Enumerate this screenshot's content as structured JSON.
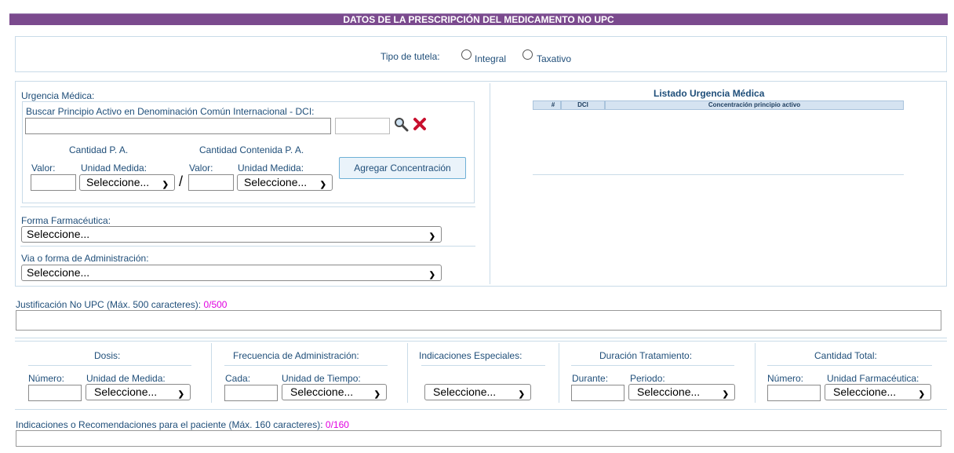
{
  "header": {
    "title": "DATOS DE LA PRESCRIPCIÓN DEL MEDICAMENTO NO UPC"
  },
  "tutela": {
    "label": "Tipo de tutela:",
    "options": [
      "Integral",
      "Taxativo"
    ]
  },
  "urgencia": {
    "title": "Urgencia Médica:",
    "search_label": "Buscar Principio Activo en Denominación Común Internacional - DCI:",
    "cantidad_pa": "Cantidad P. A.",
    "cantidad_contenida": "Cantidad Contenida P. A.",
    "valor": "Valor:",
    "unidad_medida": "Unidad Medida:",
    "select_value": "Seleccione...",
    "separator": "/",
    "add_button": "Agregar Concentración",
    "forma_label": "Forma Farmacéutica:",
    "via_label": "Via o forma de Administración:"
  },
  "listado": {
    "title": "Listado Urgencia Médica",
    "columns": [
      "#",
      "DCI",
      "Concentración principio activo"
    ]
  },
  "justificacion": {
    "label": "Justificación No UPC (Máx. 500 caracteres):",
    "counter": "0/500"
  },
  "dosis": {
    "title": "Dosis:",
    "numero": "Número:",
    "unidad": "Unidad de Medida:",
    "select": "Seleccione..."
  },
  "frecuencia": {
    "title": "Frecuencia de Administración:",
    "cada": "Cada:",
    "unidad": "Unidad de Tiempo:",
    "select": "Seleccione..."
  },
  "indicaciones_esp": {
    "title": "Indicaciones Especiales:",
    "select": "Seleccione..."
  },
  "duracion": {
    "title": "Duración Tratamiento:",
    "durante": "Durante:",
    "periodo": "Periodo:",
    "select": "Seleccione..."
  },
  "cantidad_total": {
    "title": "Cantidad Total:",
    "numero": "Número:",
    "unidad": "Unidad Farmacéutica:",
    "select": "Seleccione..."
  },
  "recomendaciones": {
    "label": "Indicaciones o Recomendaciones para el paciente (Máx. 160 caracteres):",
    "counter": "0/160"
  },
  "colors": {
    "header_bg": "#7b4a8e",
    "text": "#1f4e79",
    "counter": "#e000e0"
  }
}
